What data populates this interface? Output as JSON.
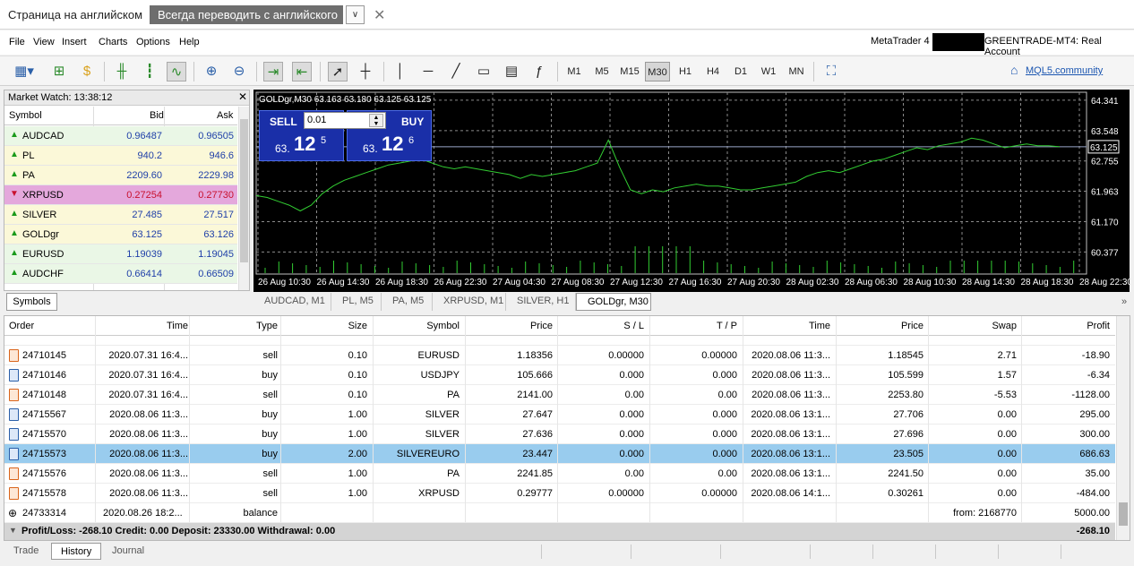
{
  "translate_bar": {
    "page_language": "Страница на английском",
    "always_translate": "Всегда переводить с английского",
    "dropdown_glyph": "∨",
    "close_glyph": "✕"
  },
  "menu": {
    "items": [
      "File",
      "View",
      "Insert",
      "Charts",
      "Options",
      "Help"
    ],
    "account_title": "MetaTrader 4",
    "account_name": "GREENTRADE-MT4: Real Account"
  },
  "toolbar": {
    "timeframes": [
      "M1",
      "M5",
      "M15",
      "M30",
      "H1",
      "H4",
      "D1",
      "W1",
      "MN"
    ],
    "active_timeframe": "M30",
    "community_link": "MQL5.community"
  },
  "market_watch": {
    "title": "Market Watch: 13:38:12",
    "close_glyph": "✕",
    "columns": {
      "symbol": "Symbol",
      "bid": "Bid",
      "ask": "Ask"
    },
    "rows": [
      {
        "symbol": "AUDCAD",
        "bid": "0.96487",
        "ask": "0.96505",
        "direction": "up"
      },
      {
        "symbol": "PL",
        "bid": "940.2",
        "ask": "946.6",
        "direction": "up"
      },
      {
        "symbol": "PA",
        "bid": "2209.60",
        "ask": "2229.98",
        "direction": "up"
      },
      {
        "symbol": "XRPUSD",
        "bid": "0.27254",
        "ask": "0.27730",
        "direction": "down"
      },
      {
        "symbol": "SILVER",
        "bid": "27.485",
        "ask": "27.517",
        "direction": "up"
      },
      {
        "symbol": "GOLDgr",
        "bid": "63.125",
        "ask": "63.126",
        "direction": "up"
      },
      {
        "symbol": "EURUSD",
        "bid": "1.19039",
        "ask": "1.19045",
        "direction": "up"
      },
      {
        "symbol": "AUDCHF",
        "bid": "0.66414",
        "ask": "0.66509",
        "direction": "up"
      }
    ],
    "tab_label": "Symbols"
  },
  "chart": {
    "caption": "GOLDgr,M30  63.163 63.180 63.125 63.125",
    "sell_label": "SELL",
    "buy_label": "BUY",
    "lot": "0.01",
    "sell_price": {
      "prefix": "63.",
      "big": "12",
      "sup": "5"
    },
    "buy_price": {
      "prefix": "63.",
      "big": "12",
      "sup": "6"
    },
    "current_price_label": "63.125",
    "colors": {
      "background": "#000000",
      "line": "#32cd32",
      "grid": "#8a8a8a",
      "volume": "#32cd32",
      "bid_line": "#9aa7c8"
    }
  },
  "chart_data": {
    "type": "line",
    "title": "GOLDgr,M30",
    "y_ticks": [
      64.341,
      63.548,
      62.755,
      61.963,
      61.17,
      60.377
    ],
    "ylim": [
      59.8,
      64.55
    ],
    "x_ticks": [
      "26 Aug 10:30",
      "26 Aug 14:30",
      "26 Aug 18:30",
      "26 Aug 22:30",
      "27 Aug 04:30",
      "27 Aug 08:30",
      "27 Aug 12:30",
      "27 Aug 16:30",
      "27 Aug 20:30",
      "28 Aug 02:30",
      "28 Aug 06:30",
      "28 Aug 10:30",
      "28 Aug 14:30",
      "28 Aug 18:30",
      "28 Aug 22:30"
    ],
    "last_price": 63.125,
    "series": [
      {
        "values": [
          61.85,
          61.8,
          61.7,
          61.6,
          61.45,
          61.6,
          61.9,
          62.1,
          62.25,
          62.35,
          62.45,
          62.55,
          62.65,
          62.7,
          62.75,
          62.8,
          62.7,
          62.6,
          62.55,
          62.6,
          62.55,
          62.5,
          62.45,
          62.4,
          62.3,
          62.4,
          62.35,
          62.4,
          62.45,
          62.5,
          62.6,
          62.7,
          63.3,
          62.6,
          62.0,
          61.9,
          62.0,
          61.95,
          62.05,
          62.1,
          62.15,
          62.1,
          62.1,
          62.05,
          62.0,
          62.0,
          62.05,
          62.1,
          62.15,
          62.2,
          62.35,
          62.45,
          62.5,
          62.45,
          62.55,
          62.65,
          62.75,
          62.8,
          62.9,
          63.0,
          63.1,
          63.05,
          63.15,
          63.2,
          63.25,
          63.35,
          63.3,
          63.2,
          63.1,
          63.15,
          63.2,
          63.15,
          63.15,
          63.125
        ]
      }
    ]
  },
  "chart_tabs": {
    "items": [
      "AUDCAD, M1",
      "PL, M5",
      "PA, M5",
      "XRPUSD, M1",
      "SILVER, H1",
      "GOLDgr, M30"
    ],
    "active": "GOLDgr, M30",
    "more_glyph": "»"
  },
  "history": {
    "columns": [
      "Order",
      "Time",
      "Type",
      "Size",
      "Symbol",
      "Price",
      "S / L",
      "T / P",
      "Time",
      "Price",
      "Swap",
      "Profit"
    ],
    "rows": [
      {
        "order": "24710145",
        "time": "2020.07.31 16:4...",
        "type": "sell",
        "size": "0.10",
        "symbol": "EURUSD",
        "price": "1.18356",
        "sl": "0.00000",
        "tp": "0.00000",
        "close_time": "2020.08.06 11:3...",
        "close_price": "1.18545",
        "swap": "2.71",
        "profit": "-18.90"
      },
      {
        "order": "24710146",
        "time": "2020.07.31 16:4...",
        "type": "buy",
        "size": "0.10",
        "symbol": "USDJPY",
        "price": "105.666",
        "sl": "0.000",
        "tp": "0.000",
        "close_time": "2020.08.06 11:3...",
        "close_price": "105.599",
        "swap": "1.57",
        "profit": "-6.34"
      },
      {
        "order": "24710148",
        "time": "2020.07.31 16:4...",
        "type": "sell",
        "size": "0.10",
        "symbol": "PA",
        "price": "2141.00",
        "sl": "0.00",
        "tp": "0.00",
        "close_time": "2020.08.06 11:3...",
        "close_price": "2253.80",
        "swap": "-5.53",
        "profit": "-1128.00"
      },
      {
        "order": "24715567",
        "time": "2020.08.06 11:3...",
        "type": "buy",
        "size": "1.00",
        "symbol": "SILVER",
        "price": "27.647",
        "sl": "0.000",
        "tp": "0.000",
        "close_time": "2020.08.06 13:1...",
        "close_price": "27.706",
        "swap": "0.00",
        "profit": "295.00"
      },
      {
        "order": "24715570",
        "time": "2020.08.06 11:3...",
        "type": "buy",
        "size": "1.00",
        "symbol": "SILVER",
        "price": "27.636",
        "sl": "0.000",
        "tp": "0.000",
        "close_time": "2020.08.06 13:1...",
        "close_price": "27.696",
        "swap": "0.00",
        "profit": "300.00"
      },
      {
        "order": "24715573",
        "time": "2020.08.06 11:3...",
        "type": "buy",
        "size": "2.00",
        "symbol": "SILVEREURO",
        "price": "23.447",
        "sl": "0.000",
        "tp": "0.000",
        "close_time": "2020.08.06 13:1...",
        "close_price": "23.505",
        "swap": "0.00",
        "profit": "686.63",
        "selected": true
      },
      {
        "order": "24715576",
        "time": "2020.08.06 11:3...",
        "type": "sell",
        "size": "1.00",
        "symbol": "PA",
        "price": "2241.85",
        "sl": "0.00",
        "tp": "0.00",
        "close_time": "2020.08.06 13:1...",
        "close_price": "2241.50",
        "swap": "0.00",
        "profit": "35.00"
      },
      {
        "order": "24715578",
        "time": "2020.08.06 11:3...",
        "type": "sell",
        "size": "1.00",
        "symbol": "XRPUSD",
        "price": "0.29777",
        "sl": "0.00000",
        "tp": "0.00000",
        "close_time": "2020.08.06 14:1...",
        "close_price": "0.30261",
        "swap": "0.00",
        "profit": "-484.00"
      }
    ],
    "balance_row": {
      "order": "24733314",
      "time": "2020.08.26 18:2...",
      "type": "balance",
      "comment": "from: 2168770",
      "profit": "5000.00"
    },
    "summary": "Profit/Loss: -268.10   Credit: 0.00   Deposit: 23330.00   Withdrawal: 0.00",
    "summary_total": "-268.10"
  },
  "bottom_tabs": {
    "items": [
      "Trade",
      "History",
      "Journal"
    ],
    "active": "History"
  }
}
